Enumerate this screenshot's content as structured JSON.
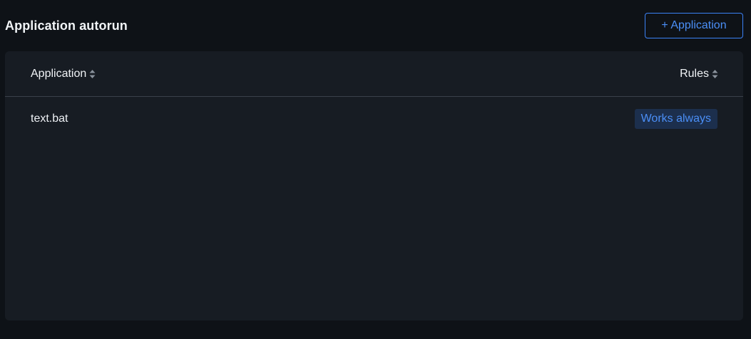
{
  "header": {
    "title": "Application autorun",
    "add_button_label": "+ Application"
  },
  "table": {
    "columns": [
      {
        "label": "Application",
        "sortable": true
      },
      {
        "label": "Rules",
        "sortable": true
      }
    ],
    "rows": [
      {
        "application": "text.bat",
        "rule": "Works always"
      }
    ]
  },
  "colors": {
    "background": "#0e1217",
    "panel": "#171c23",
    "accent": "#3b82f6",
    "badge_bg": "#1c2f4d"
  },
  "icons": {
    "sort": "sort-icon"
  }
}
